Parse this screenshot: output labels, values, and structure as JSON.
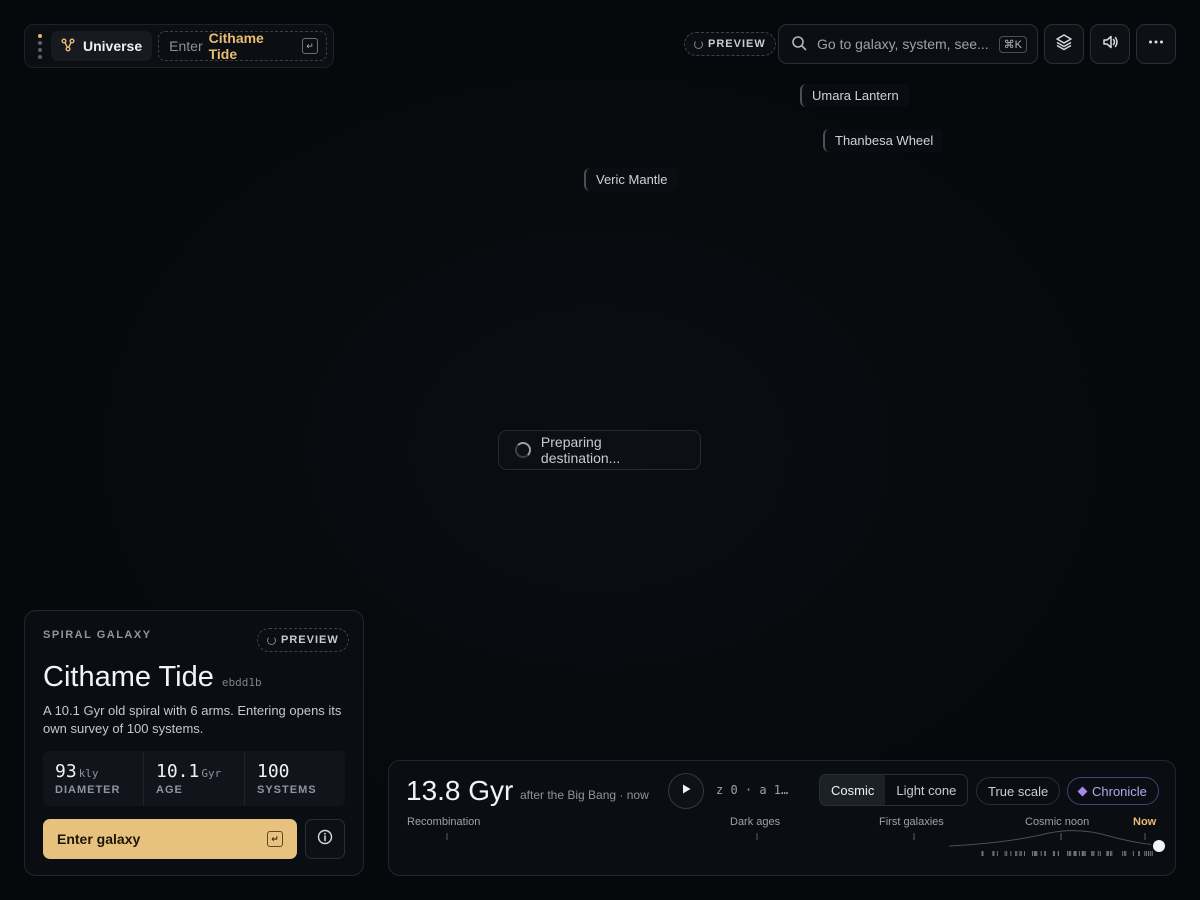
{
  "breadcrumb": {
    "root_label": "Universe",
    "enter_prefix": "Enter",
    "enter_target": "Cithame Tide",
    "enter_key": "↵"
  },
  "topbar": {
    "preview_label": "PREVIEW",
    "search_placeholder": "Go to galaxy, system, see...",
    "search_shortcut": "⌘K",
    "icons": [
      "layers-icon",
      "speaker-icon",
      "more-icon"
    ]
  },
  "map_labels": [
    "Umara Lantern",
    "Thanbesa Wheel",
    "Veric Mantle"
  ],
  "loading_text": "Preparing destination...",
  "info_panel": {
    "kind": "SPIRAL GALAXY",
    "preview_label": "PREVIEW",
    "name": "Cithame Tide",
    "hash": "ebdd1b",
    "description": "A 10.1 Gyr old spiral with 6 arms. Entering opens its own survey of 100 systems.",
    "stats": [
      {
        "value": "93",
        "unit": "kly",
        "label": "DIAMETER"
      },
      {
        "value": "10.1",
        "unit": "Gyr",
        "label": "AGE"
      },
      {
        "value": "100",
        "unit": "",
        "label": "SYSTEMS"
      }
    ],
    "enter_label": "Enter galaxy",
    "enter_key": "↵"
  },
  "timeline": {
    "time_value": "13.8 Gyr",
    "time_caption": "after the Big Bang · now",
    "z_readout": "z 0 · a 1…",
    "modes": [
      "Cosmic",
      "Light cone"
    ],
    "selected_mode": "Cosmic",
    "true_scale_label": "True scale",
    "chronicle_label": "Chronicle",
    "eras": [
      "Recombination",
      "Dark ages",
      "First galaxies",
      "Cosmic noon",
      "Now"
    ],
    "position_fraction": 1.0
  },
  "colors": {
    "accent": "#e6c27e",
    "chronicle": "#a38ae8",
    "background": "#06080b"
  }
}
